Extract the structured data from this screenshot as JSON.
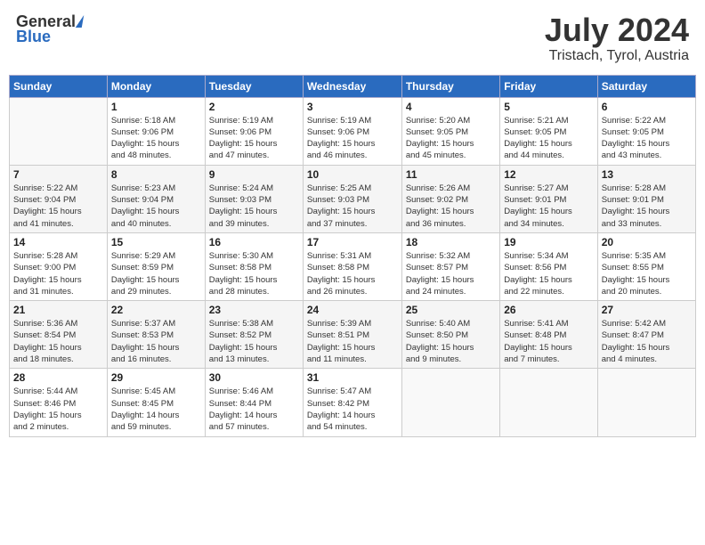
{
  "header": {
    "logo_general": "General",
    "logo_blue": "Blue",
    "month": "July 2024",
    "location": "Tristach, Tyrol, Austria"
  },
  "columns": [
    "Sunday",
    "Monday",
    "Tuesday",
    "Wednesday",
    "Thursday",
    "Friday",
    "Saturday"
  ],
  "weeks": [
    [
      {
        "day": "",
        "info": ""
      },
      {
        "day": "1",
        "info": "Sunrise: 5:18 AM\nSunset: 9:06 PM\nDaylight: 15 hours\nand 48 minutes."
      },
      {
        "day": "2",
        "info": "Sunrise: 5:19 AM\nSunset: 9:06 PM\nDaylight: 15 hours\nand 47 minutes."
      },
      {
        "day": "3",
        "info": "Sunrise: 5:19 AM\nSunset: 9:06 PM\nDaylight: 15 hours\nand 46 minutes."
      },
      {
        "day": "4",
        "info": "Sunrise: 5:20 AM\nSunset: 9:05 PM\nDaylight: 15 hours\nand 45 minutes."
      },
      {
        "day": "5",
        "info": "Sunrise: 5:21 AM\nSunset: 9:05 PM\nDaylight: 15 hours\nand 44 minutes."
      },
      {
        "day": "6",
        "info": "Sunrise: 5:22 AM\nSunset: 9:05 PM\nDaylight: 15 hours\nand 43 minutes."
      }
    ],
    [
      {
        "day": "7",
        "info": "Sunrise: 5:22 AM\nSunset: 9:04 PM\nDaylight: 15 hours\nand 41 minutes."
      },
      {
        "day": "8",
        "info": "Sunrise: 5:23 AM\nSunset: 9:04 PM\nDaylight: 15 hours\nand 40 minutes."
      },
      {
        "day": "9",
        "info": "Sunrise: 5:24 AM\nSunset: 9:03 PM\nDaylight: 15 hours\nand 39 minutes."
      },
      {
        "day": "10",
        "info": "Sunrise: 5:25 AM\nSunset: 9:03 PM\nDaylight: 15 hours\nand 37 minutes."
      },
      {
        "day": "11",
        "info": "Sunrise: 5:26 AM\nSunset: 9:02 PM\nDaylight: 15 hours\nand 36 minutes."
      },
      {
        "day": "12",
        "info": "Sunrise: 5:27 AM\nSunset: 9:01 PM\nDaylight: 15 hours\nand 34 minutes."
      },
      {
        "day": "13",
        "info": "Sunrise: 5:28 AM\nSunset: 9:01 PM\nDaylight: 15 hours\nand 33 minutes."
      }
    ],
    [
      {
        "day": "14",
        "info": "Sunrise: 5:28 AM\nSunset: 9:00 PM\nDaylight: 15 hours\nand 31 minutes."
      },
      {
        "day": "15",
        "info": "Sunrise: 5:29 AM\nSunset: 8:59 PM\nDaylight: 15 hours\nand 29 minutes."
      },
      {
        "day": "16",
        "info": "Sunrise: 5:30 AM\nSunset: 8:58 PM\nDaylight: 15 hours\nand 28 minutes."
      },
      {
        "day": "17",
        "info": "Sunrise: 5:31 AM\nSunset: 8:58 PM\nDaylight: 15 hours\nand 26 minutes."
      },
      {
        "day": "18",
        "info": "Sunrise: 5:32 AM\nSunset: 8:57 PM\nDaylight: 15 hours\nand 24 minutes."
      },
      {
        "day": "19",
        "info": "Sunrise: 5:34 AM\nSunset: 8:56 PM\nDaylight: 15 hours\nand 22 minutes."
      },
      {
        "day": "20",
        "info": "Sunrise: 5:35 AM\nSunset: 8:55 PM\nDaylight: 15 hours\nand 20 minutes."
      }
    ],
    [
      {
        "day": "21",
        "info": "Sunrise: 5:36 AM\nSunset: 8:54 PM\nDaylight: 15 hours\nand 18 minutes."
      },
      {
        "day": "22",
        "info": "Sunrise: 5:37 AM\nSunset: 8:53 PM\nDaylight: 15 hours\nand 16 minutes."
      },
      {
        "day": "23",
        "info": "Sunrise: 5:38 AM\nSunset: 8:52 PM\nDaylight: 15 hours\nand 13 minutes."
      },
      {
        "day": "24",
        "info": "Sunrise: 5:39 AM\nSunset: 8:51 PM\nDaylight: 15 hours\nand 11 minutes."
      },
      {
        "day": "25",
        "info": "Sunrise: 5:40 AM\nSunset: 8:50 PM\nDaylight: 15 hours\nand 9 minutes."
      },
      {
        "day": "26",
        "info": "Sunrise: 5:41 AM\nSunset: 8:48 PM\nDaylight: 15 hours\nand 7 minutes."
      },
      {
        "day": "27",
        "info": "Sunrise: 5:42 AM\nSunset: 8:47 PM\nDaylight: 15 hours\nand 4 minutes."
      }
    ],
    [
      {
        "day": "28",
        "info": "Sunrise: 5:44 AM\nSunset: 8:46 PM\nDaylight: 15 hours\nand 2 minutes."
      },
      {
        "day": "29",
        "info": "Sunrise: 5:45 AM\nSunset: 8:45 PM\nDaylight: 14 hours\nand 59 minutes."
      },
      {
        "day": "30",
        "info": "Sunrise: 5:46 AM\nSunset: 8:44 PM\nDaylight: 14 hours\nand 57 minutes."
      },
      {
        "day": "31",
        "info": "Sunrise: 5:47 AM\nSunset: 8:42 PM\nDaylight: 14 hours\nand 54 minutes."
      },
      {
        "day": "",
        "info": ""
      },
      {
        "day": "",
        "info": ""
      },
      {
        "day": "",
        "info": ""
      }
    ]
  ]
}
